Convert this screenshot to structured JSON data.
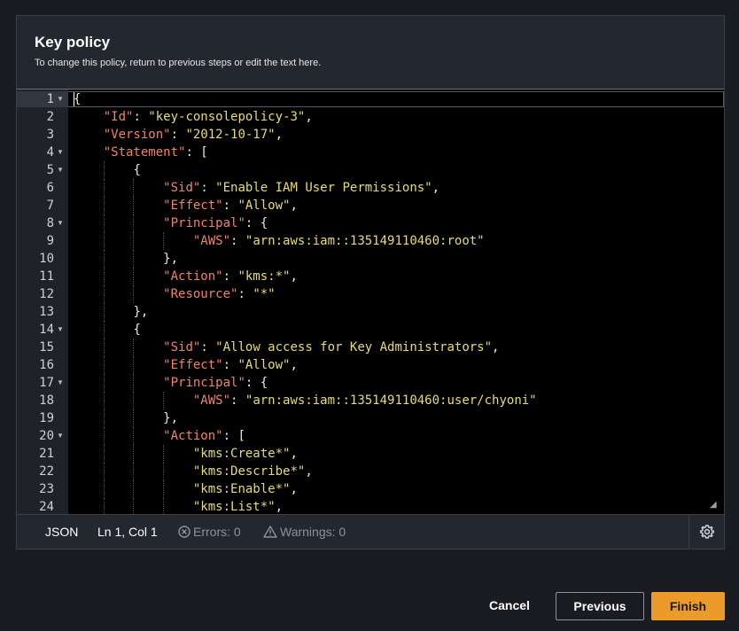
{
  "colors": {
    "accent": "#ec9a2a",
    "key": "#f0826a",
    "string": "#e6db74",
    "background": "#1a1c22"
  },
  "panel": {
    "title": "Key policy",
    "description": "To change this policy, return to previous steps or edit the text here."
  },
  "editor": {
    "lines": [
      {
        "num": "1",
        "fold": true,
        "indent": 0,
        "tokens": [
          {
            "t": "p",
            "v": "{"
          }
        ]
      },
      {
        "num": "2",
        "fold": false,
        "indent": 1,
        "tokens": [
          {
            "t": "k",
            "v": "\"Id\""
          },
          {
            "t": "p",
            "v": ": "
          },
          {
            "t": "s",
            "v": "\"key-consolepolicy-3\""
          },
          {
            "t": "p",
            "v": ","
          }
        ]
      },
      {
        "num": "3",
        "fold": false,
        "indent": 1,
        "tokens": [
          {
            "t": "k",
            "v": "\"Version\""
          },
          {
            "t": "p",
            "v": ": "
          },
          {
            "t": "s",
            "v": "\"2012-10-17\""
          },
          {
            "t": "p",
            "v": ","
          }
        ]
      },
      {
        "num": "4",
        "fold": true,
        "indent": 1,
        "tokens": [
          {
            "t": "k",
            "v": "\"Statement\""
          },
          {
            "t": "p",
            "v": ": ["
          }
        ]
      },
      {
        "num": "5",
        "fold": true,
        "indent": 2,
        "tokens": [
          {
            "t": "p",
            "v": "{"
          }
        ]
      },
      {
        "num": "6",
        "fold": false,
        "indent": 3,
        "tokens": [
          {
            "t": "k",
            "v": "\"Sid\""
          },
          {
            "t": "p",
            "v": ": "
          },
          {
            "t": "s",
            "v": "\"Enable IAM User Permissions\""
          },
          {
            "t": "p",
            "v": ","
          }
        ]
      },
      {
        "num": "7",
        "fold": false,
        "indent": 3,
        "tokens": [
          {
            "t": "k",
            "v": "\"Effect\""
          },
          {
            "t": "p",
            "v": ": "
          },
          {
            "t": "s",
            "v": "\"Allow\""
          },
          {
            "t": "p",
            "v": ","
          }
        ]
      },
      {
        "num": "8",
        "fold": true,
        "indent": 3,
        "tokens": [
          {
            "t": "k",
            "v": "\"Principal\""
          },
          {
            "t": "p",
            "v": ": {"
          }
        ]
      },
      {
        "num": "9",
        "fold": false,
        "indent": 4,
        "tokens": [
          {
            "t": "k",
            "v": "\"AWS\""
          },
          {
            "t": "p",
            "v": ": "
          },
          {
            "t": "s",
            "v": "\"arn:aws:iam::135149110460:root\""
          }
        ]
      },
      {
        "num": "10",
        "fold": false,
        "indent": 3,
        "tokens": [
          {
            "t": "p",
            "v": "},"
          }
        ]
      },
      {
        "num": "11",
        "fold": false,
        "indent": 3,
        "tokens": [
          {
            "t": "k",
            "v": "\"Action\""
          },
          {
            "t": "p",
            "v": ": "
          },
          {
            "t": "s",
            "v": "\"kms:*\""
          },
          {
            "t": "p",
            "v": ","
          }
        ]
      },
      {
        "num": "12",
        "fold": false,
        "indent": 3,
        "tokens": [
          {
            "t": "k",
            "v": "\"Resource\""
          },
          {
            "t": "p",
            "v": ": "
          },
          {
            "t": "s",
            "v": "\"*\""
          }
        ]
      },
      {
        "num": "13",
        "fold": false,
        "indent": 2,
        "tokens": [
          {
            "t": "p",
            "v": "},"
          }
        ]
      },
      {
        "num": "14",
        "fold": true,
        "indent": 2,
        "tokens": [
          {
            "t": "p",
            "v": "{"
          }
        ]
      },
      {
        "num": "15",
        "fold": false,
        "indent": 3,
        "tokens": [
          {
            "t": "k",
            "v": "\"Sid\""
          },
          {
            "t": "p",
            "v": ": "
          },
          {
            "t": "s",
            "v": "\"Allow access for Key Administrators\""
          },
          {
            "t": "p",
            "v": ","
          }
        ]
      },
      {
        "num": "16",
        "fold": false,
        "indent": 3,
        "tokens": [
          {
            "t": "k",
            "v": "\"Effect\""
          },
          {
            "t": "p",
            "v": ": "
          },
          {
            "t": "s",
            "v": "\"Allow\""
          },
          {
            "t": "p",
            "v": ","
          }
        ]
      },
      {
        "num": "17",
        "fold": true,
        "indent": 3,
        "tokens": [
          {
            "t": "k",
            "v": "\"Principal\""
          },
          {
            "t": "p",
            "v": ": {"
          }
        ]
      },
      {
        "num": "18",
        "fold": false,
        "indent": 4,
        "tokens": [
          {
            "t": "k",
            "v": "\"AWS\""
          },
          {
            "t": "p",
            "v": ": "
          },
          {
            "t": "s",
            "v": "\"arn:aws:iam::135149110460:user/chyoni\""
          }
        ]
      },
      {
        "num": "19",
        "fold": false,
        "indent": 3,
        "tokens": [
          {
            "t": "p",
            "v": "},"
          }
        ]
      },
      {
        "num": "20",
        "fold": true,
        "indent": 3,
        "tokens": [
          {
            "t": "k",
            "v": "\"Action\""
          },
          {
            "t": "p",
            "v": ": ["
          }
        ]
      },
      {
        "num": "21",
        "fold": false,
        "indent": 4,
        "tokens": [
          {
            "t": "s",
            "v": "\"kms:Create*\""
          },
          {
            "t": "p",
            "v": ","
          }
        ]
      },
      {
        "num": "22",
        "fold": false,
        "indent": 4,
        "tokens": [
          {
            "t": "s",
            "v": "\"kms:Describe*\""
          },
          {
            "t": "p",
            "v": ","
          }
        ]
      },
      {
        "num": "23",
        "fold": false,
        "indent": 4,
        "tokens": [
          {
            "t": "s",
            "v": "\"kms:Enable*\""
          },
          {
            "t": "p",
            "v": ","
          }
        ]
      },
      {
        "num": "24",
        "fold": false,
        "indent": 4,
        "tokens": [
          {
            "t": "s",
            "v": "\"kms:List*\""
          },
          {
            "t": "p",
            "v": ","
          }
        ]
      }
    ]
  },
  "statusbar": {
    "language": "JSON",
    "position": "Ln 1, Col 1",
    "errors": "Errors: 0",
    "warnings": "Warnings: 0",
    "settings_icon": "gear-icon"
  },
  "footer": {
    "cancel_label": "Cancel",
    "previous_label": "Previous",
    "finish_label": "Finish"
  }
}
